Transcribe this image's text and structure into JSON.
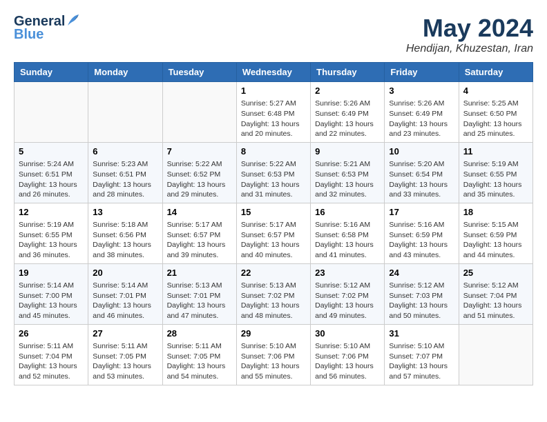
{
  "logo": {
    "line1": "General",
    "line2": "Blue"
  },
  "title": "May 2024",
  "subtitle": "Hendijan, Khuzestan, Iran",
  "calendar": {
    "headers": [
      "Sunday",
      "Monday",
      "Tuesday",
      "Wednesday",
      "Thursday",
      "Friday",
      "Saturday"
    ],
    "weeks": [
      [
        {
          "day": "",
          "info": ""
        },
        {
          "day": "",
          "info": ""
        },
        {
          "day": "",
          "info": ""
        },
        {
          "day": "1",
          "info": "Sunrise: 5:27 AM\nSunset: 6:48 PM\nDaylight: 13 hours\nand 20 minutes."
        },
        {
          "day": "2",
          "info": "Sunrise: 5:26 AM\nSunset: 6:49 PM\nDaylight: 13 hours\nand 22 minutes."
        },
        {
          "day": "3",
          "info": "Sunrise: 5:26 AM\nSunset: 6:49 PM\nDaylight: 13 hours\nand 23 minutes."
        },
        {
          "day": "4",
          "info": "Sunrise: 5:25 AM\nSunset: 6:50 PM\nDaylight: 13 hours\nand 25 minutes."
        }
      ],
      [
        {
          "day": "5",
          "info": "Sunrise: 5:24 AM\nSunset: 6:51 PM\nDaylight: 13 hours\nand 26 minutes."
        },
        {
          "day": "6",
          "info": "Sunrise: 5:23 AM\nSunset: 6:51 PM\nDaylight: 13 hours\nand 28 minutes."
        },
        {
          "day": "7",
          "info": "Sunrise: 5:22 AM\nSunset: 6:52 PM\nDaylight: 13 hours\nand 29 minutes."
        },
        {
          "day": "8",
          "info": "Sunrise: 5:22 AM\nSunset: 6:53 PM\nDaylight: 13 hours\nand 31 minutes."
        },
        {
          "day": "9",
          "info": "Sunrise: 5:21 AM\nSunset: 6:53 PM\nDaylight: 13 hours\nand 32 minutes."
        },
        {
          "day": "10",
          "info": "Sunrise: 5:20 AM\nSunset: 6:54 PM\nDaylight: 13 hours\nand 33 minutes."
        },
        {
          "day": "11",
          "info": "Sunrise: 5:19 AM\nSunset: 6:55 PM\nDaylight: 13 hours\nand 35 minutes."
        }
      ],
      [
        {
          "day": "12",
          "info": "Sunrise: 5:19 AM\nSunset: 6:55 PM\nDaylight: 13 hours\nand 36 minutes."
        },
        {
          "day": "13",
          "info": "Sunrise: 5:18 AM\nSunset: 6:56 PM\nDaylight: 13 hours\nand 38 minutes."
        },
        {
          "day": "14",
          "info": "Sunrise: 5:17 AM\nSunset: 6:57 PM\nDaylight: 13 hours\nand 39 minutes."
        },
        {
          "day": "15",
          "info": "Sunrise: 5:17 AM\nSunset: 6:57 PM\nDaylight: 13 hours\nand 40 minutes."
        },
        {
          "day": "16",
          "info": "Sunrise: 5:16 AM\nSunset: 6:58 PM\nDaylight: 13 hours\nand 41 minutes."
        },
        {
          "day": "17",
          "info": "Sunrise: 5:16 AM\nSunset: 6:59 PM\nDaylight: 13 hours\nand 43 minutes."
        },
        {
          "day": "18",
          "info": "Sunrise: 5:15 AM\nSunset: 6:59 PM\nDaylight: 13 hours\nand 44 minutes."
        }
      ],
      [
        {
          "day": "19",
          "info": "Sunrise: 5:14 AM\nSunset: 7:00 PM\nDaylight: 13 hours\nand 45 minutes."
        },
        {
          "day": "20",
          "info": "Sunrise: 5:14 AM\nSunset: 7:01 PM\nDaylight: 13 hours\nand 46 minutes."
        },
        {
          "day": "21",
          "info": "Sunrise: 5:13 AM\nSunset: 7:01 PM\nDaylight: 13 hours\nand 47 minutes."
        },
        {
          "day": "22",
          "info": "Sunrise: 5:13 AM\nSunset: 7:02 PM\nDaylight: 13 hours\nand 48 minutes."
        },
        {
          "day": "23",
          "info": "Sunrise: 5:12 AM\nSunset: 7:02 PM\nDaylight: 13 hours\nand 49 minutes."
        },
        {
          "day": "24",
          "info": "Sunrise: 5:12 AM\nSunset: 7:03 PM\nDaylight: 13 hours\nand 50 minutes."
        },
        {
          "day": "25",
          "info": "Sunrise: 5:12 AM\nSunset: 7:04 PM\nDaylight: 13 hours\nand 51 minutes."
        }
      ],
      [
        {
          "day": "26",
          "info": "Sunrise: 5:11 AM\nSunset: 7:04 PM\nDaylight: 13 hours\nand 52 minutes."
        },
        {
          "day": "27",
          "info": "Sunrise: 5:11 AM\nSunset: 7:05 PM\nDaylight: 13 hours\nand 53 minutes."
        },
        {
          "day": "28",
          "info": "Sunrise: 5:11 AM\nSunset: 7:05 PM\nDaylight: 13 hours\nand 54 minutes."
        },
        {
          "day": "29",
          "info": "Sunrise: 5:10 AM\nSunset: 7:06 PM\nDaylight: 13 hours\nand 55 minutes."
        },
        {
          "day": "30",
          "info": "Sunrise: 5:10 AM\nSunset: 7:06 PM\nDaylight: 13 hours\nand 56 minutes."
        },
        {
          "day": "31",
          "info": "Sunrise: 5:10 AM\nSunset: 7:07 PM\nDaylight: 13 hours\nand 57 minutes."
        },
        {
          "day": "",
          "info": ""
        }
      ]
    ]
  }
}
